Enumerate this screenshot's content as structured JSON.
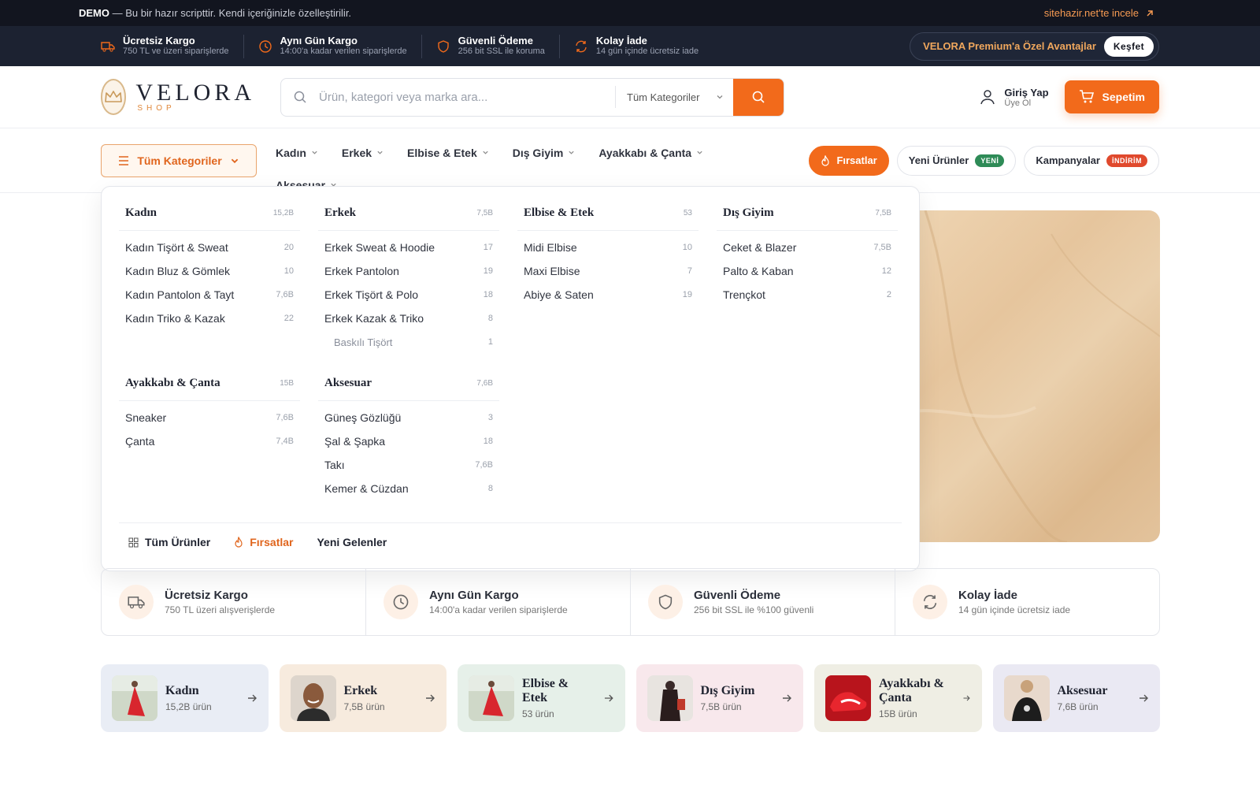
{
  "demo_bar": {
    "bold": "DEMO",
    "text": " — Bu bir hazır scripttir. Kendi içeriğinizle özelleştirilir.",
    "link": "sitehazir.net'te incele"
  },
  "info_bar": {
    "items": [
      {
        "title": "Ücretsiz Kargo",
        "sub": "750 TL ve üzeri siparişlerde",
        "icon": "truck-icon"
      },
      {
        "title": "Aynı Gün Kargo",
        "sub": "14:00'a kadar verilen siparişlerde",
        "icon": "clock-icon"
      },
      {
        "title": "Güvenli Ödeme",
        "sub": "256 bit SSL ile koruma",
        "icon": "shield-icon"
      },
      {
        "title": "Kolay İade",
        "sub": "14 gün içinde ücretsiz iade",
        "icon": "refresh-icon"
      }
    ],
    "premium_text": "VELORA Premium'a Özel Avantajlar",
    "premium_button": "Keşfet"
  },
  "header": {
    "logo_name": "VELORA",
    "logo_sub": "SHOP",
    "search_placeholder": "Ürün, kategori veya marka ara...",
    "search_category": "Tüm Kategoriler",
    "login_title": "Giriş Yap",
    "login_sub": "Üye Ol",
    "cart_label": "Sepetim"
  },
  "nav": {
    "all_categories": "Tüm Kategoriler",
    "links": [
      "Kadın",
      "Erkek",
      "Elbise & Etek",
      "Dış Giyim",
      "Ayakkabı & Çanta",
      "Aksesuar"
    ],
    "deals": "Fırsatlar",
    "new_products": "Yeni Ürünler",
    "new_tag": "YENİ",
    "campaigns": "Kampanyalar",
    "campaign_tag": "İNDİRİM"
  },
  "mega_menu": {
    "columns": [
      {
        "name": "Kadın",
        "count": "15,2B",
        "items": [
          [
            "Kadın Tişört & Sweat",
            "20"
          ],
          [
            "Kadın Bluz & Gömlek",
            "10"
          ],
          [
            "Kadın Pantolon & Tayt",
            "7,6B"
          ],
          [
            "Kadın Triko & Kazak",
            "22"
          ]
        ]
      },
      {
        "name": "Erkek",
        "count": "7,5B",
        "items": [
          [
            "Erkek Sweat & Hoodie",
            "17"
          ],
          [
            "Erkek Pantolon",
            "19"
          ],
          [
            "Erkek Tişört & Polo",
            "18"
          ],
          [
            "Erkek Kazak & Triko",
            "8"
          ]
        ],
        "sub": [
          "Baskılı Tişört",
          "1"
        ]
      },
      {
        "name": "Elbise & Etek",
        "count": "53",
        "items": [
          [
            "Midi Elbise",
            "10"
          ],
          [
            "Maxi Elbise",
            "7"
          ],
          [
            "Abiye & Saten",
            "19"
          ]
        ]
      },
      {
        "name": "Dış Giyim",
        "count": "7,5B",
        "items": [
          [
            "Ceket & Blazer",
            "7,5B"
          ],
          [
            "Palto & Kaban",
            "12"
          ],
          [
            "Trençkot",
            "2"
          ]
        ]
      },
      {
        "name": "Ayakkabı & Çanta",
        "count": "15B",
        "items": [
          [
            "Sneaker",
            "7,6B"
          ],
          [
            "Çanta",
            "7,4B"
          ]
        ]
      },
      {
        "name": "Aksesuar",
        "count": "7,6B",
        "items": [
          [
            "Güneş Gözlüğü",
            "3"
          ],
          [
            "Şal & Şapka",
            "18"
          ],
          [
            "Takı",
            "7,6B"
          ],
          [
            "Kemer & Cüzdan",
            "8"
          ]
        ]
      }
    ],
    "footer": {
      "all": "Tüm Ürünler",
      "deals": "Fırsatlar",
      "new": "Yeni Gelenler"
    }
  },
  "features": [
    {
      "title": "Ücretsiz Kargo",
      "sub": "750 TL üzeri alışverişlerde"
    },
    {
      "title": "Aynı Gün Kargo",
      "sub": "14:00'a kadar verilen siparişlerde"
    },
    {
      "title": "Güvenli Ödeme",
      "sub": "256 bit SSL ile %100 güvenli"
    },
    {
      "title": "Kolay İade",
      "sub": "14 gün içinde ücretsiz iade"
    }
  ],
  "category_cards": [
    {
      "name": "Kadın",
      "count": "15,2B ürün",
      "bg": "#e9edf5"
    },
    {
      "name": "Erkek",
      "count": "7,5B ürün",
      "bg": "#f7ebde"
    },
    {
      "name": "Elbise & Etek",
      "count": "53 ürün",
      "bg": "#e6f0e9"
    },
    {
      "name": "Dış Giyim",
      "count": "7,5B ürün",
      "bg": "#f8e8ec"
    },
    {
      "name": "Ayakkabı & Çanta",
      "count": "15B ürün",
      "bg": "#efeee4"
    },
    {
      "name": "Aksesuar",
      "count": "7,6B ürün",
      "bg": "#eae9f3"
    }
  ],
  "colors": {
    "accent": "#f26a1b",
    "dark": "#12151f",
    "info_bg": "#1c2231",
    "new_tag": "#2e8b57",
    "sale_tag": "#e0492d"
  }
}
